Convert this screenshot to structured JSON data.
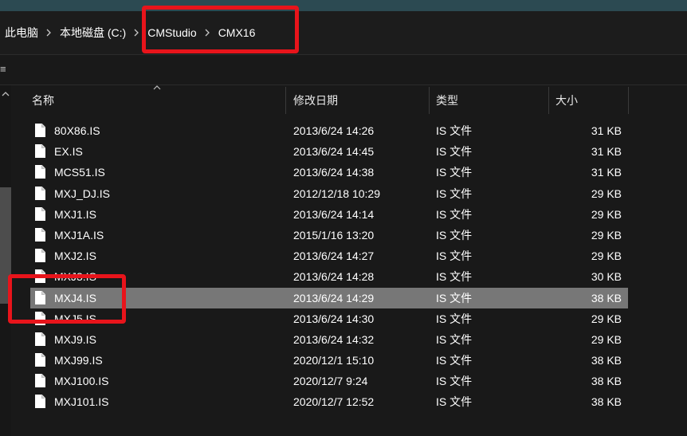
{
  "breadcrumb": {
    "items": [
      "此电脑",
      "本地磁盘 (C:)",
      "CMStudio",
      "CMX16"
    ],
    "separator_icon": "chevron-right-icon"
  },
  "toolbar": {
    "glyph": "≡"
  },
  "columns": {
    "name": "名称",
    "date": "修改日期",
    "type": "类型",
    "size": "大小"
  },
  "files": [
    {
      "name": "80X86.IS",
      "date": "2013/6/24 14:26",
      "type": "IS 文件",
      "size": "31 KB"
    },
    {
      "name": "EX.IS",
      "date": "2013/6/24 14:45",
      "type": "IS 文件",
      "size": "31 KB"
    },
    {
      "name": "MCS51.IS",
      "date": "2013/6/24 14:38",
      "type": "IS 文件",
      "size": "31 KB"
    },
    {
      "name": "MXJ_DJ.IS",
      "date": "2012/12/18 10:29",
      "type": "IS 文件",
      "size": "29 KB"
    },
    {
      "name": "MXJ1.IS",
      "date": "2013/6/24 14:14",
      "type": "IS 文件",
      "size": "29 KB"
    },
    {
      "name": "MXJ1A.IS",
      "date": "2015/1/16 13:20",
      "type": "IS 文件",
      "size": "29 KB"
    },
    {
      "name": "MXJ2.IS",
      "date": "2013/6/24 14:27",
      "type": "IS 文件",
      "size": "29 KB"
    },
    {
      "name": "MXJ3.IS",
      "date": "2013/6/24 14:28",
      "type": "IS 文件",
      "size": "30 KB"
    },
    {
      "name": "MXJ4.IS",
      "date": "2013/6/24 14:29",
      "type": "IS 文件",
      "size": "38 KB",
      "selected": true
    },
    {
      "name": "MXJ5.IS",
      "date": "2013/6/24 14:30",
      "type": "IS 文件",
      "size": "29 KB"
    },
    {
      "name": "MXJ9.IS",
      "date": "2013/6/24 14:32",
      "type": "IS 文件",
      "size": "29 KB"
    },
    {
      "name": "MXJ99.IS",
      "date": "2020/12/1 15:10",
      "type": "IS 文件",
      "size": "38 KB"
    },
    {
      "name": "MXJ100.IS",
      "date": "2020/12/7 9:24",
      "type": "IS 文件",
      "size": "38 KB"
    },
    {
      "name": "MXJ101.IS",
      "date": "2020/12/7 12:52",
      "type": "IS 文件",
      "size": "38 KB"
    }
  ],
  "colors": {
    "background": "#191919",
    "selected_row": "#777777",
    "annotation_red": "#e8141b",
    "title_strip": "#2c4a52"
  }
}
